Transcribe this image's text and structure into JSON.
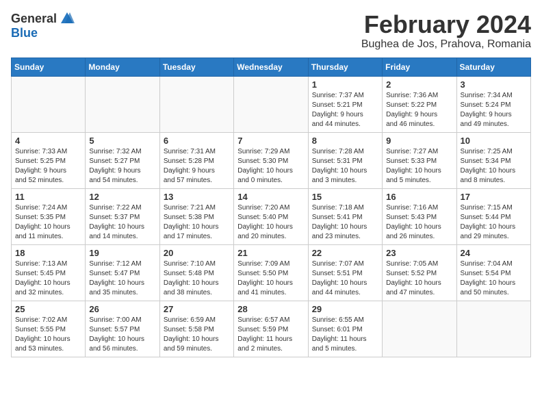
{
  "header": {
    "logo_general": "General",
    "logo_blue": "Blue",
    "month_title": "February 2024",
    "location": "Bughea de Jos, Prahova, Romania"
  },
  "weekdays": [
    "Sunday",
    "Monday",
    "Tuesday",
    "Wednesday",
    "Thursday",
    "Friday",
    "Saturday"
  ],
  "weeks": [
    [
      {
        "day": "",
        "detail": ""
      },
      {
        "day": "",
        "detail": ""
      },
      {
        "day": "",
        "detail": ""
      },
      {
        "day": "",
        "detail": ""
      },
      {
        "day": "1",
        "detail": "Sunrise: 7:37 AM\nSunset: 5:21 PM\nDaylight: 9 hours\nand 44 minutes."
      },
      {
        "day": "2",
        "detail": "Sunrise: 7:36 AM\nSunset: 5:22 PM\nDaylight: 9 hours\nand 46 minutes."
      },
      {
        "day": "3",
        "detail": "Sunrise: 7:34 AM\nSunset: 5:24 PM\nDaylight: 9 hours\nand 49 minutes."
      }
    ],
    [
      {
        "day": "4",
        "detail": "Sunrise: 7:33 AM\nSunset: 5:25 PM\nDaylight: 9 hours\nand 52 minutes."
      },
      {
        "day": "5",
        "detail": "Sunrise: 7:32 AM\nSunset: 5:27 PM\nDaylight: 9 hours\nand 54 minutes."
      },
      {
        "day": "6",
        "detail": "Sunrise: 7:31 AM\nSunset: 5:28 PM\nDaylight: 9 hours\nand 57 minutes."
      },
      {
        "day": "7",
        "detail": "Sunrise: 7:29 AM\nSunset: 5:30 PM\nDaylight: 10 hours\nand 0 minutes."
      },
      {
        "day": "8",
        "detail": "Sunrise: 7:28 AM\nSunset: 5:31 PM\nDaylight: 10 hours\nand 3 minutes."
      },
      {
        "day": "9",
        "detail": "Sunrise: 7:27 AM\nSunset: 5:33 PM\nDaylight: 10 hours\nand 5 minutes."
      },
      {
        "day": "10",
        "detail": "Sunrise: 7:25 AM\nSunset: 5:34 PM\nDaylight: 10 hours\nand 8 minutes."
      }
    ],
    [
      {
        "day": "11",
        "detail": "Sunrise: 7:24 AM\nSunset: 5:35 PM\nDaylight: 10 hours\nand 11 minutes."
      },
      {
        "day": "12",
        "detail": "Sunrise: 7:22 AM\nSunset: 5:37 PM\nDaylight: 10 hours\nand 14 minutes."
      },
      {
        "day": "13",
        "detail": "Sunrise: 7:21 AM\nSunset: 5:38 PM\nDaylight: 10 hours\nand 17 minutes."
      },
      {
        "day": "14",
        "detail": "Sunrise: 7:20 AM\nSunset: 5:40 PM\nDaylight: 10 hours\nand 20 minutes."
      },
      {
        "day": "15",
        "detail": "Sunrise: 7:18 AM\nSunset: 5:41 PM\nDaylight: 10 hours\nand 23 minutes."
      },
      {
        "day": "16",
        "detail": "Sunrise: 7:16 AM\nSunset: 5:43 PM\nDaylight: 10 hours\nand 26 minutes."
      },
      {
        "day": "17",
        "detail": "Sunrise: 7:15 AM\nSunset: 5:44 PM\nDaylight: 10 hours\nand 29 minutes."
      }
    ],
    [
      {
        "day": "18",
        "detail": "Sunrise: 7:13 AM\nSunset: 5:45 PM\nDaylight: 10 hours\nand 32 minutes."
      },
      {
        "day": "19",
        "detail": "Sunrise: 7:12 AM\nSunset: 5:47 PM\nDaylight: 10 hours\nand 35 minutes."
      },
      {
        "day": "20",
        "detail": "Sunrise: 7:10 AM\nSunset: 5:48 PM\nDaylight: 10 hours\nand 38 minutes."
      },
      {
        "day": "21",
        "detail": "Sunrise: 7:09 AM\nSunset: 5:50 PM\nDaylight: 10 hours\nand 41 minutes."
      },
      {
        "day": "22",
        "detail": "Sunrise: 7:07 AM\nSunset: 5:51 PM\nDaylight: 10 hours\nand 44 minutes."
      },
      {
        "day": "23",
        "detail": "Sunrise: 7:05 AM\nSunset: 5:52 PM\nDaylight: 10 hours\nand 47 minutes."
      },
      {
        "day": "24",
        "detail": "Sunrise: 7:04 AM\nSunset: 5:54 PM\nDaylight: 10 hours\nand 50 minutes."
      }
    ],
    [
      {
        "day": "25",
        "detail": "Sunrise: 7:02 AM\nSunset: 5:55 PM\nDaylight: 10 hours\nand 53 minutes."
      },
      {
        "day": "26",
        "detail": "Sunrise: 7:00 AM\nSunset: 5:57 PM\nDaylight: 10 hours\nand 56 minutes."
      },
      {
        "day": "27",
        "detail": "Sunrise: 6:59 AM\nSunset: 5:58 PM\nDaylight: 10 hours\nand 59 minutes."
      },
      {
        "day": "28",
        "detail": "Sunrise: 6:57 AM\nSunset: 5:59 PM\nDaylight: 11 hours\nand 2 minutes."
      },
      {
        "day": "29",
        "detail": "Sunrise: 6:55 AM\nSunset: 6:01 PM\nDaylight: 11 hours\nand 5 minutes."
      },
      {
        "day": "",
        "detail": ""
      },
      {
        "day": "",
        "detail": ""
      }
    ]
  ]
}
